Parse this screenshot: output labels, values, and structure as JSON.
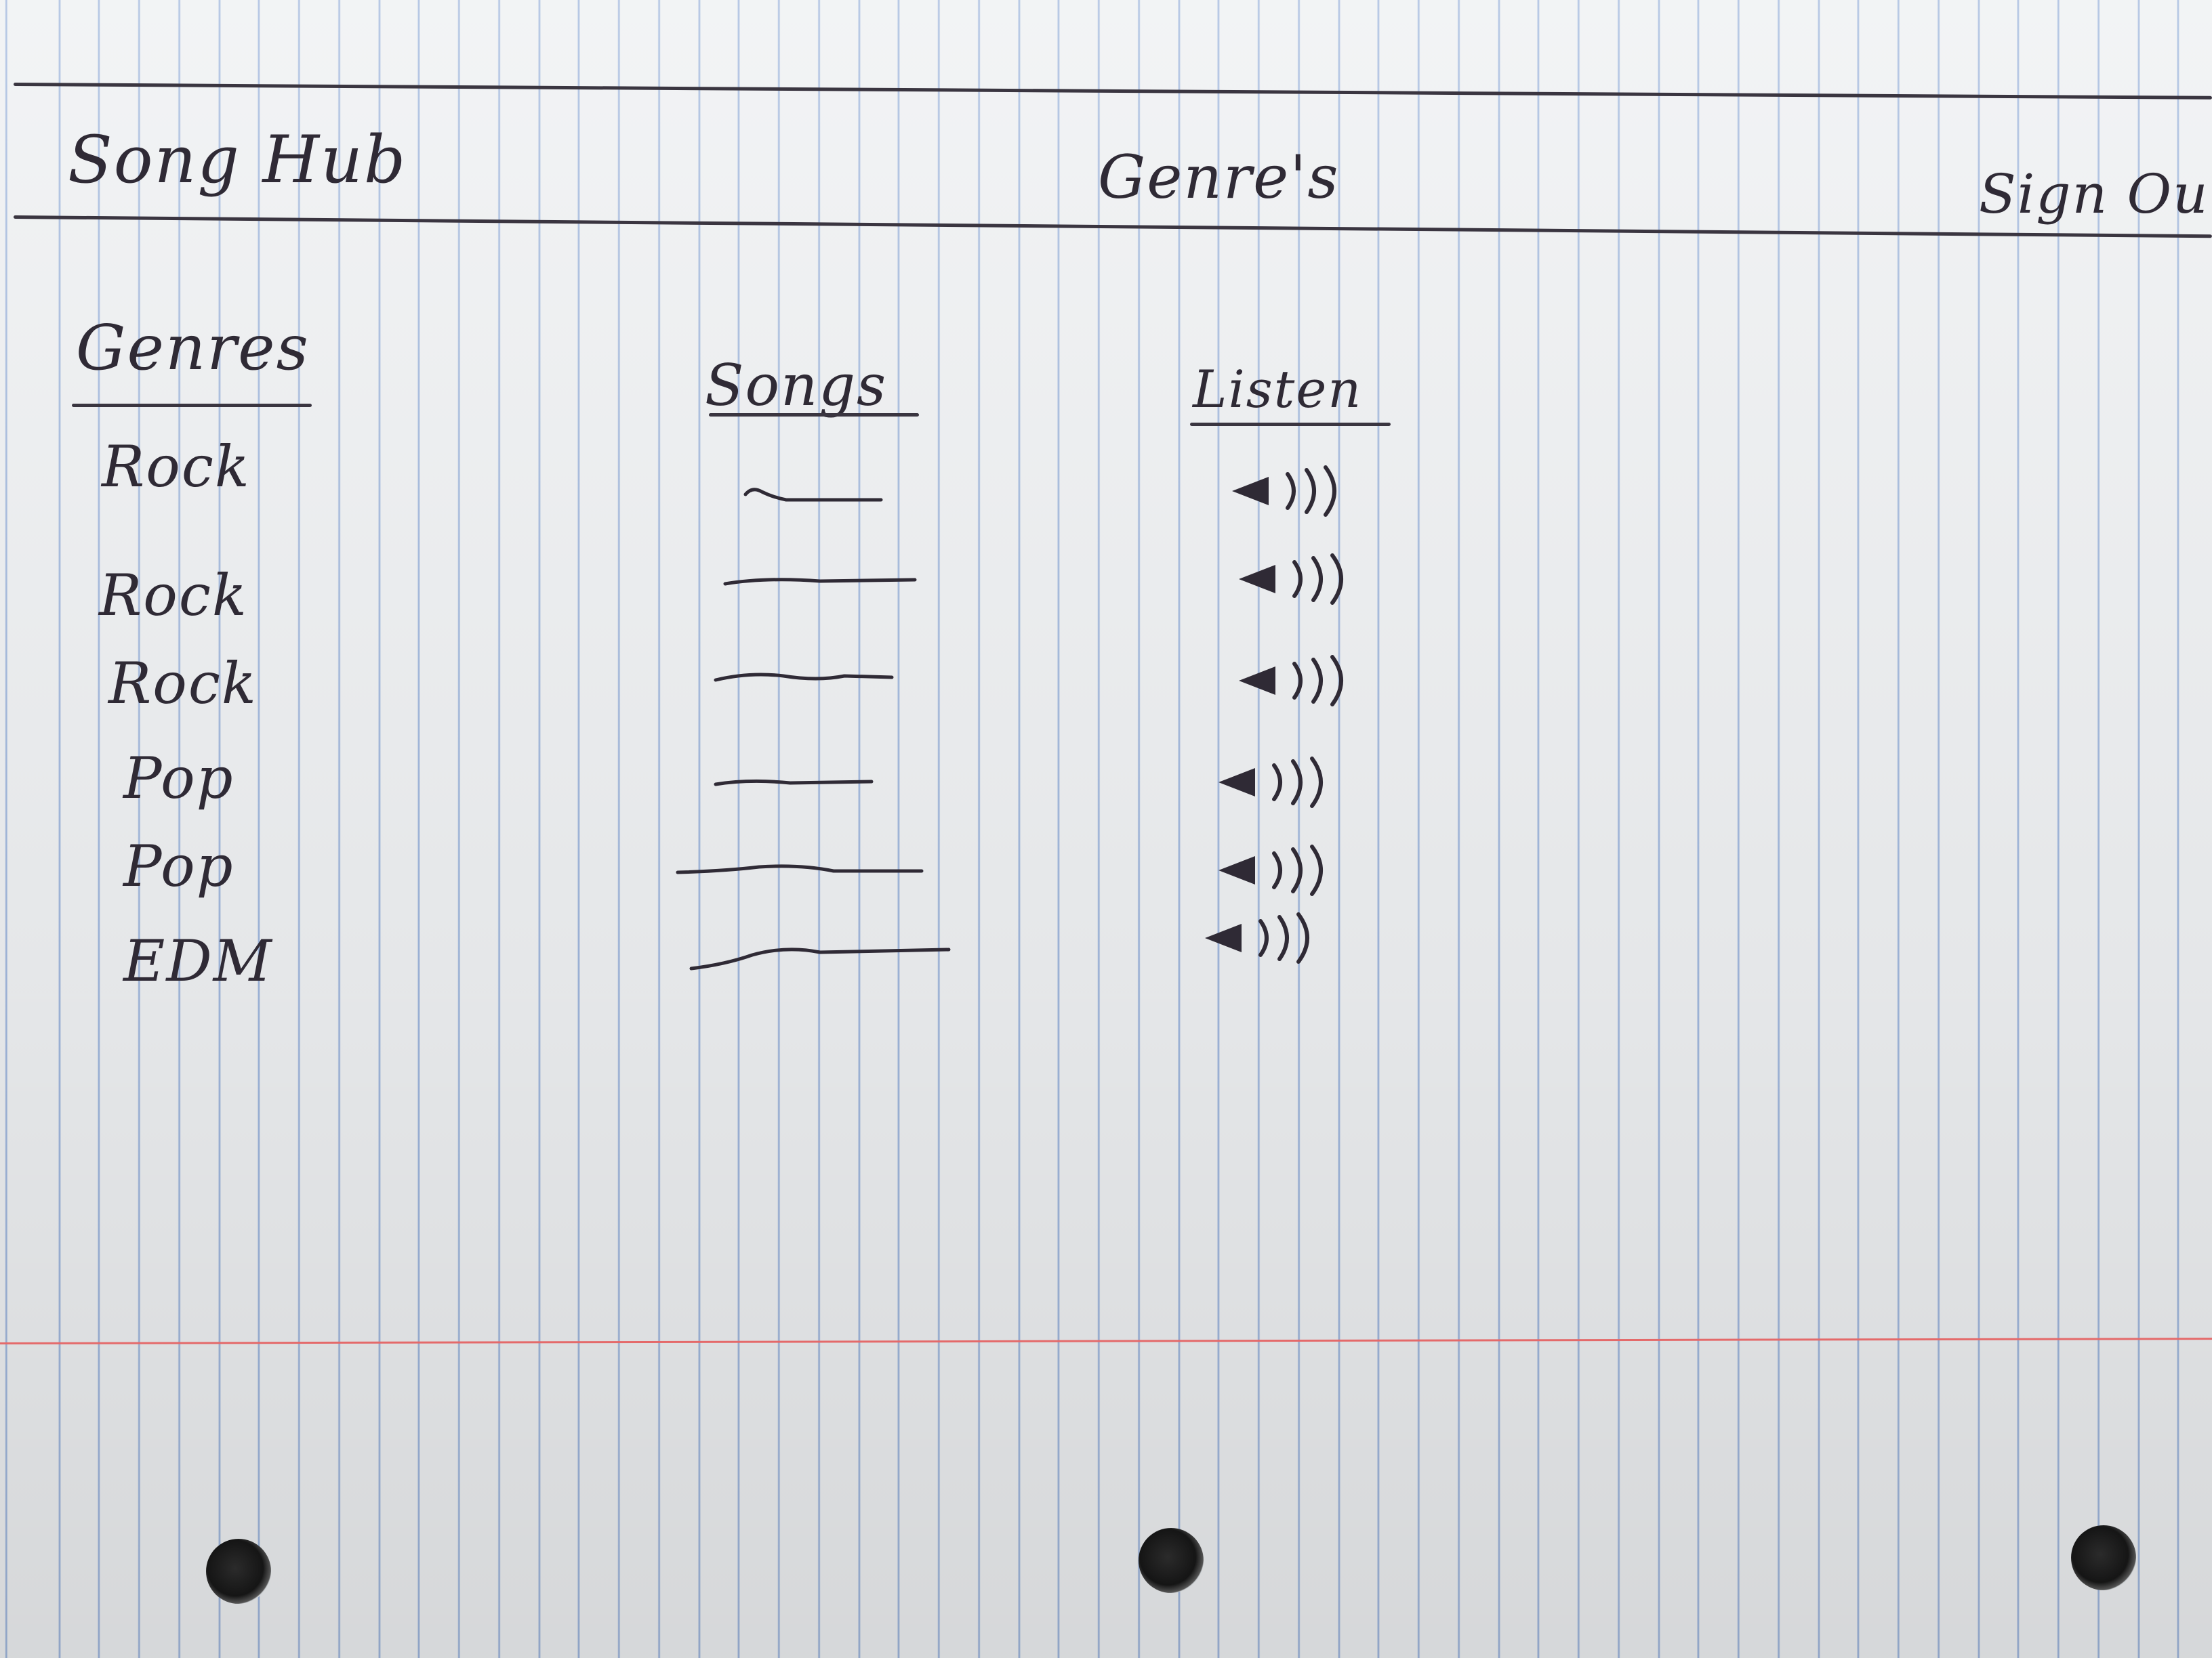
{
  "navbar": {
    "brand": "Song Hub",
    "page_title": "Genre's",
    "sign_out": "Sign Out"
  },
  "table": {
    "headers": {
      "genres": "Genres",
      "songs": "Songs",
      "listen": "Listen"
    },
    "rows": [
      {
        "genre": "Rock"
      },
      {
        "genre": "Rock"
      },
      {
        "genre": "Rock"
      },
      {
        "genre": "Pop"
      },
      {
        "genre": "Pop"
      },
      {
        "genre": "EDM"
      }
    ]
  },
  "icons": {
    "listen": "speaker-icon"
  },
  "colors": {
    "ink": "#2f2a35",
    "paper_rule": "#9fb6dc",
    "margin_rule": "#e46a6a"
  }
}
